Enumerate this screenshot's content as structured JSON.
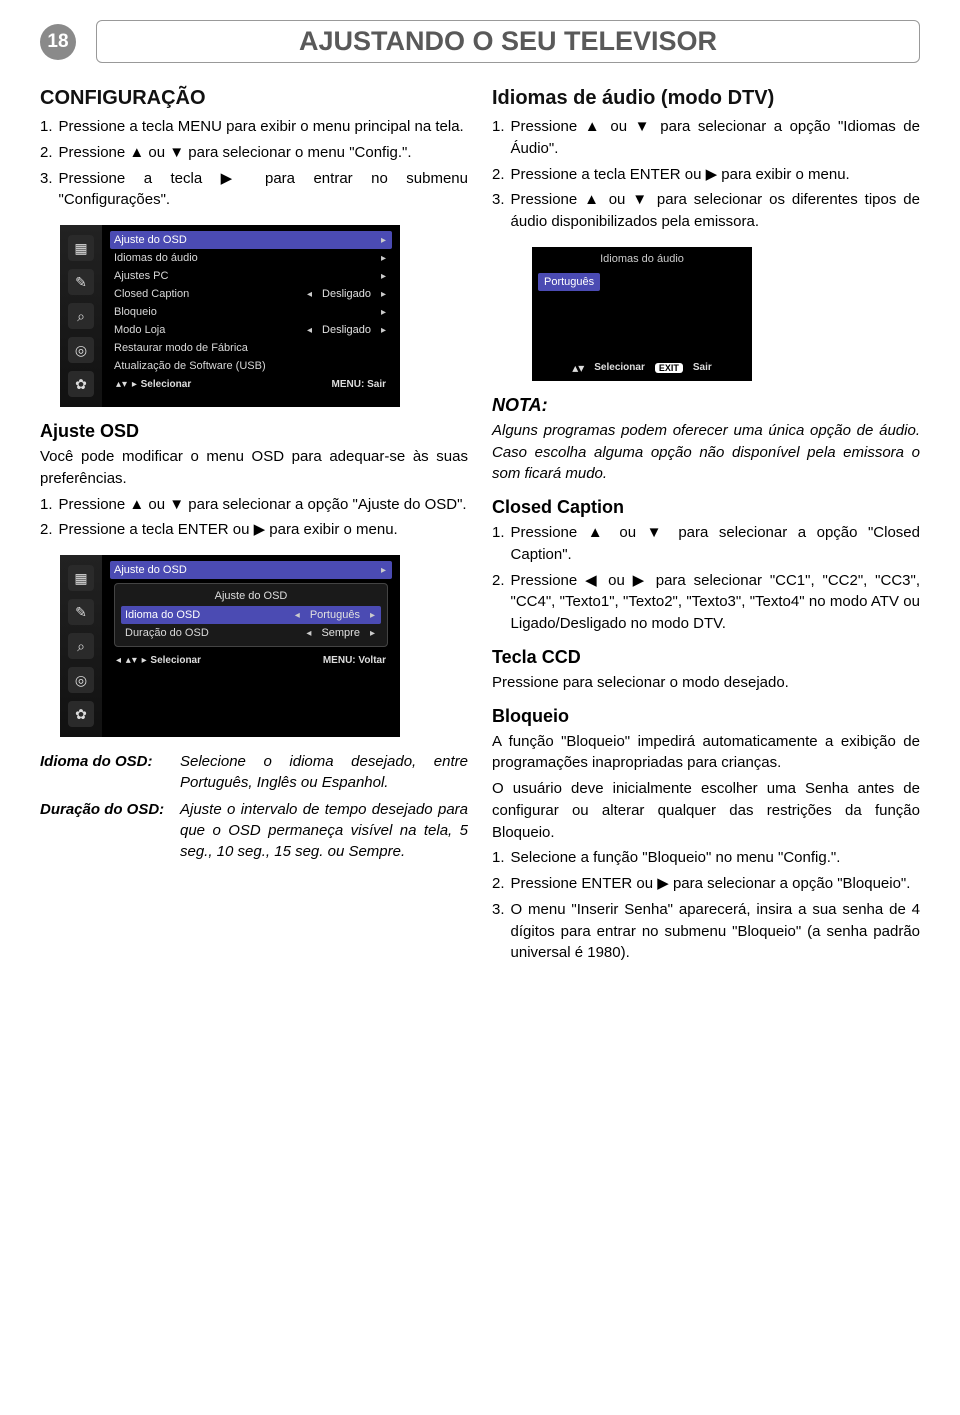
{
  "page_number": "18",
  "page_title": "AJUSTANDO O SEU TELEVISOR",
  "left": {
    "config_heading": "CONFIGURAÇÃO",
    "step1": "Pressione a tecla MENU para exibir o menu principal na tela.",
    "step2": "Pressione ▲ ou ▼ para selecionar o menu \"Config.\".",
    "step3": "Pressione a tecla ▶ para entrar no submenu \"Configurações\".",
    "osd1": {
      "side_label": "CONFIG.",
      "row_sel": "Ajuste do OSD",
      "rows": [
        {
          "label": "Idiomas do áudio",
          "val": "",
          "r": "▸"
        },
        {
          "label": "Ajustes PC",
          "val": "",
          "r": "▸"
        },
        {
          "label": "Closed Caption",
          "val": "Desligado",
          "l": "◂",
          "r": "▸"
        },
        {
          "label": "Bloqueio",
          "val": "",
          "r": "▸"
        },
        {
          "label": "Modo Loja",
          "val": "Desligado",
          "l": "◂",
          "r": "▸"
        },
        {
          "label": "Restaurar modo de Fábrica",
          "val": "",
          "r": ""
        },
        {
          "label": "Atualização de Software (USB)",
          "val": "",
          "r": ""
        }
      ],
      "footer_left_sym": "▴▾ ▸",
      "footer_left": "Selecionar",
      "footer_right": "MENU: Sair"
    },
    "ajuste_heading": "Ajuste OSD",
    "ajuste_intro": "Você pode modificar o menu OSD para adequar-se às suas preferências.",
    "ajuste_step1": "Pressione ▲ ou ▼ para selecionar a opção \"Ajuste do OSD\".",
    "ajuste_step2": "Pressione a tecla ENTER ou ▶ para exibir o menu.",
    "osd2": {
      "side_label": "CONFIG.",
      "row_sel": "Ajuste do OSD",
      "sub_title": "Ajuste do OSD",
      "sub_rows": [
        {
          "label": "Idioma do OSD",
          "val": "Português",
          "sel": true
        },
        {
          "label": "Duração do OSD",
          "val": "Sempre",
          "sel": false
        }
      ],
      "footer_left_sym": "◂ ▴▾ ▸",
      "footer_left": "Selecionar",
      "footer_right": "MENU: Voltar"
    },
    "defs": {
      "idioma_term": "Idioma do OSD:",
      "idioma_desc": "Selecione o idioma desejado, entre Português, Inglês ou Espanhol.",
      "duracao_term": "Duração do OSD:",
      "duracao_desc": "Ajuste o intervalo de tempo desejado para que o OSD permaneça visível na tela, 5 seg., 10 seg., 15 seg. ou Sempre."
    }
  },
  "right": {
    "audio_heading": "Idiomas de áudio (modo DTV)",
    "audio_step1": "Pressione ▲ ou ▼ para selecionar a opção \"Idiomas de Áudio\".",
    "audio_step2": "Pressione a tecla ENTER ou ▶ para exibir o menu.",
    "audio_step3": "Pressione ▲ ou ▼ para selecionar os diferentes tipos de áudio disponibilizados pela emissora.",
    "osd_small": {
      "title": "Idiomas do áudio",
      "item": "Português",
      "footer_sel_sym": "▴▾",
      "footer_sel": "Selecionar",
      "footer_exit": "EXIT",
      "footer_sair": "Sair"
    },
    "nota_heading": "NOTA:",
    "nota_text": "Alguns programas podem oferecer uma única opção de áudio. Caso escolha alguma opção não disponível pela emissora o som ficará mudo.",
    "cc_heading": "Closed Caption",
    "cc_step1": "Pressione ▲ ou ▼ para selecionar a opção \"Closed Caption\".",
    "cc_step2": "Pressione ◀ ou ▶ para selecionar \"CC1\", \"CC2\", \"CC3\", \"CC4\", \"Texto1\", \"Texto2\", \"Texto3\", \"Texto4\" no modo ATV ou Ligado/Desligado no modo DTV.",
    "ccd_heading": "Tecla CCD",
    "ccd_text": "Pressione para selecionar o modo desejado.",
    "bloq_heading": "Bloqueio",
    "bloq_p1": "A função \"Bloqueio\" impedirá automaticamente a exibição de programações inapropriadas para crianças.",
    "bloq_p2": "O usuário deve inicialmente escolher uma Senha antes de configurar ou alterar qualquer das restrições da função Bloqueio.",
    "bloq_step1": "Selecione a função \"Bloqueio\" no menu \"Config.\".",
    "bloq_step2": "Pressione ENTER ou ▶ para selecionar a opção \"Bloqueio\".",
    "bloq_step3": "O menu \"Inserir Senha\" aparecerá, insira a sua senha de 4 dígitos para entrar no submenu \"Bloqueio\" (a senha padrão universal é 1980)."
  }
}
